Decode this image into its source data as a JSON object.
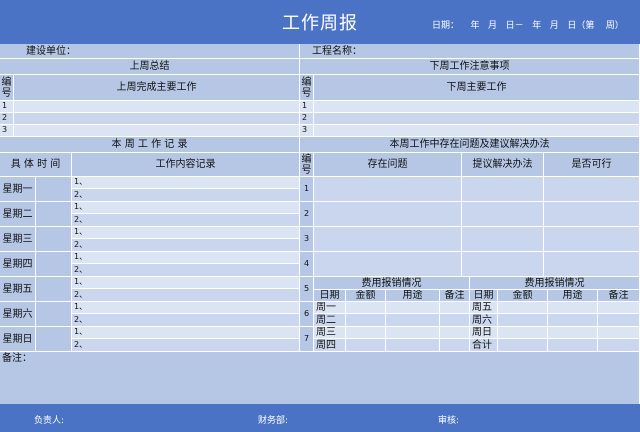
{
  "header": {
    "title": "工作周报",
    "date_line": "日期：    年   月   日－   年   月   日（第    周）"
  },
  "info": {
    "unit_label": "建设单位：",
    "project_label": "工程名称："
  },
  "left": {
    "last_week_summary": "上周总结",
    "number_header": "编号",
    "main_work_done": "上周完成主要工作",
    "rows": [
      "1",
      "2",
      "3"
    ],
    "week_record_title": "本 周 工 作 记 录",
    "time_header": "具 体 时 间",
    "content_header": "工作内容记录",
    "days": [
      {
        "label": "星期一",
        "items": [
          "1、",
          "2、"
        ]
      },
      {
        "label": "星期二",
        "items": [
          "1、",
          "2、"
        ]
      },
      {
        "label": "星期三",
        "items": [
          "1、",
          "2、"
        ]
      },
      {
        "label": "星期四",
        "items": [
          "1、",
          "2、"
        ]
      },
      {
        "label": "星期五",
        "items": [
          "1、",
          "2、"
        ]
      },
      {
        "label": "星期六",
        "items": [
          "1、",
          "2、"
        ]
      },
      {
        "label": "星期日",
        "items": [
          "1、",
          "2、"
        ]
      }
    ],
    "remarks_label": "备注："
  },
  "right": {
    "next_week_notes": "下周工作注意事项",
    "number_header": "编号",
    "next_week_main": "下周主要工作",
    "rows": [
      "1",
      "2",
      "3"
    ],
    "problems_title": "本周工作中存在问题及建议解决办法",
    "problem_header": "存在问题",
    "solution_header": "提议解决办法",
    "feasible_header": "是否可行",
    "problem_rows": [
      "1",
      "2",
      "3",
      "4",
      "5",
      "6",
      "7"
    ],
    "expense_title": "费用报销情况",
    "expense_cols": [
      "日期",
      "金额",
      "用途",
      "备注"
    ],
    "expense_days_left": [
      "周一",
      "周二",
      "周三",
      "周四"
    ],
    "expense_days_right": [
      "周五",
      "周六",
      "周日",
      "合计"
    ]
  },
  "footer": {
    "manager": "负责人:",
    "finance": "财务部:",
    "review": "审核:"
  }
}
